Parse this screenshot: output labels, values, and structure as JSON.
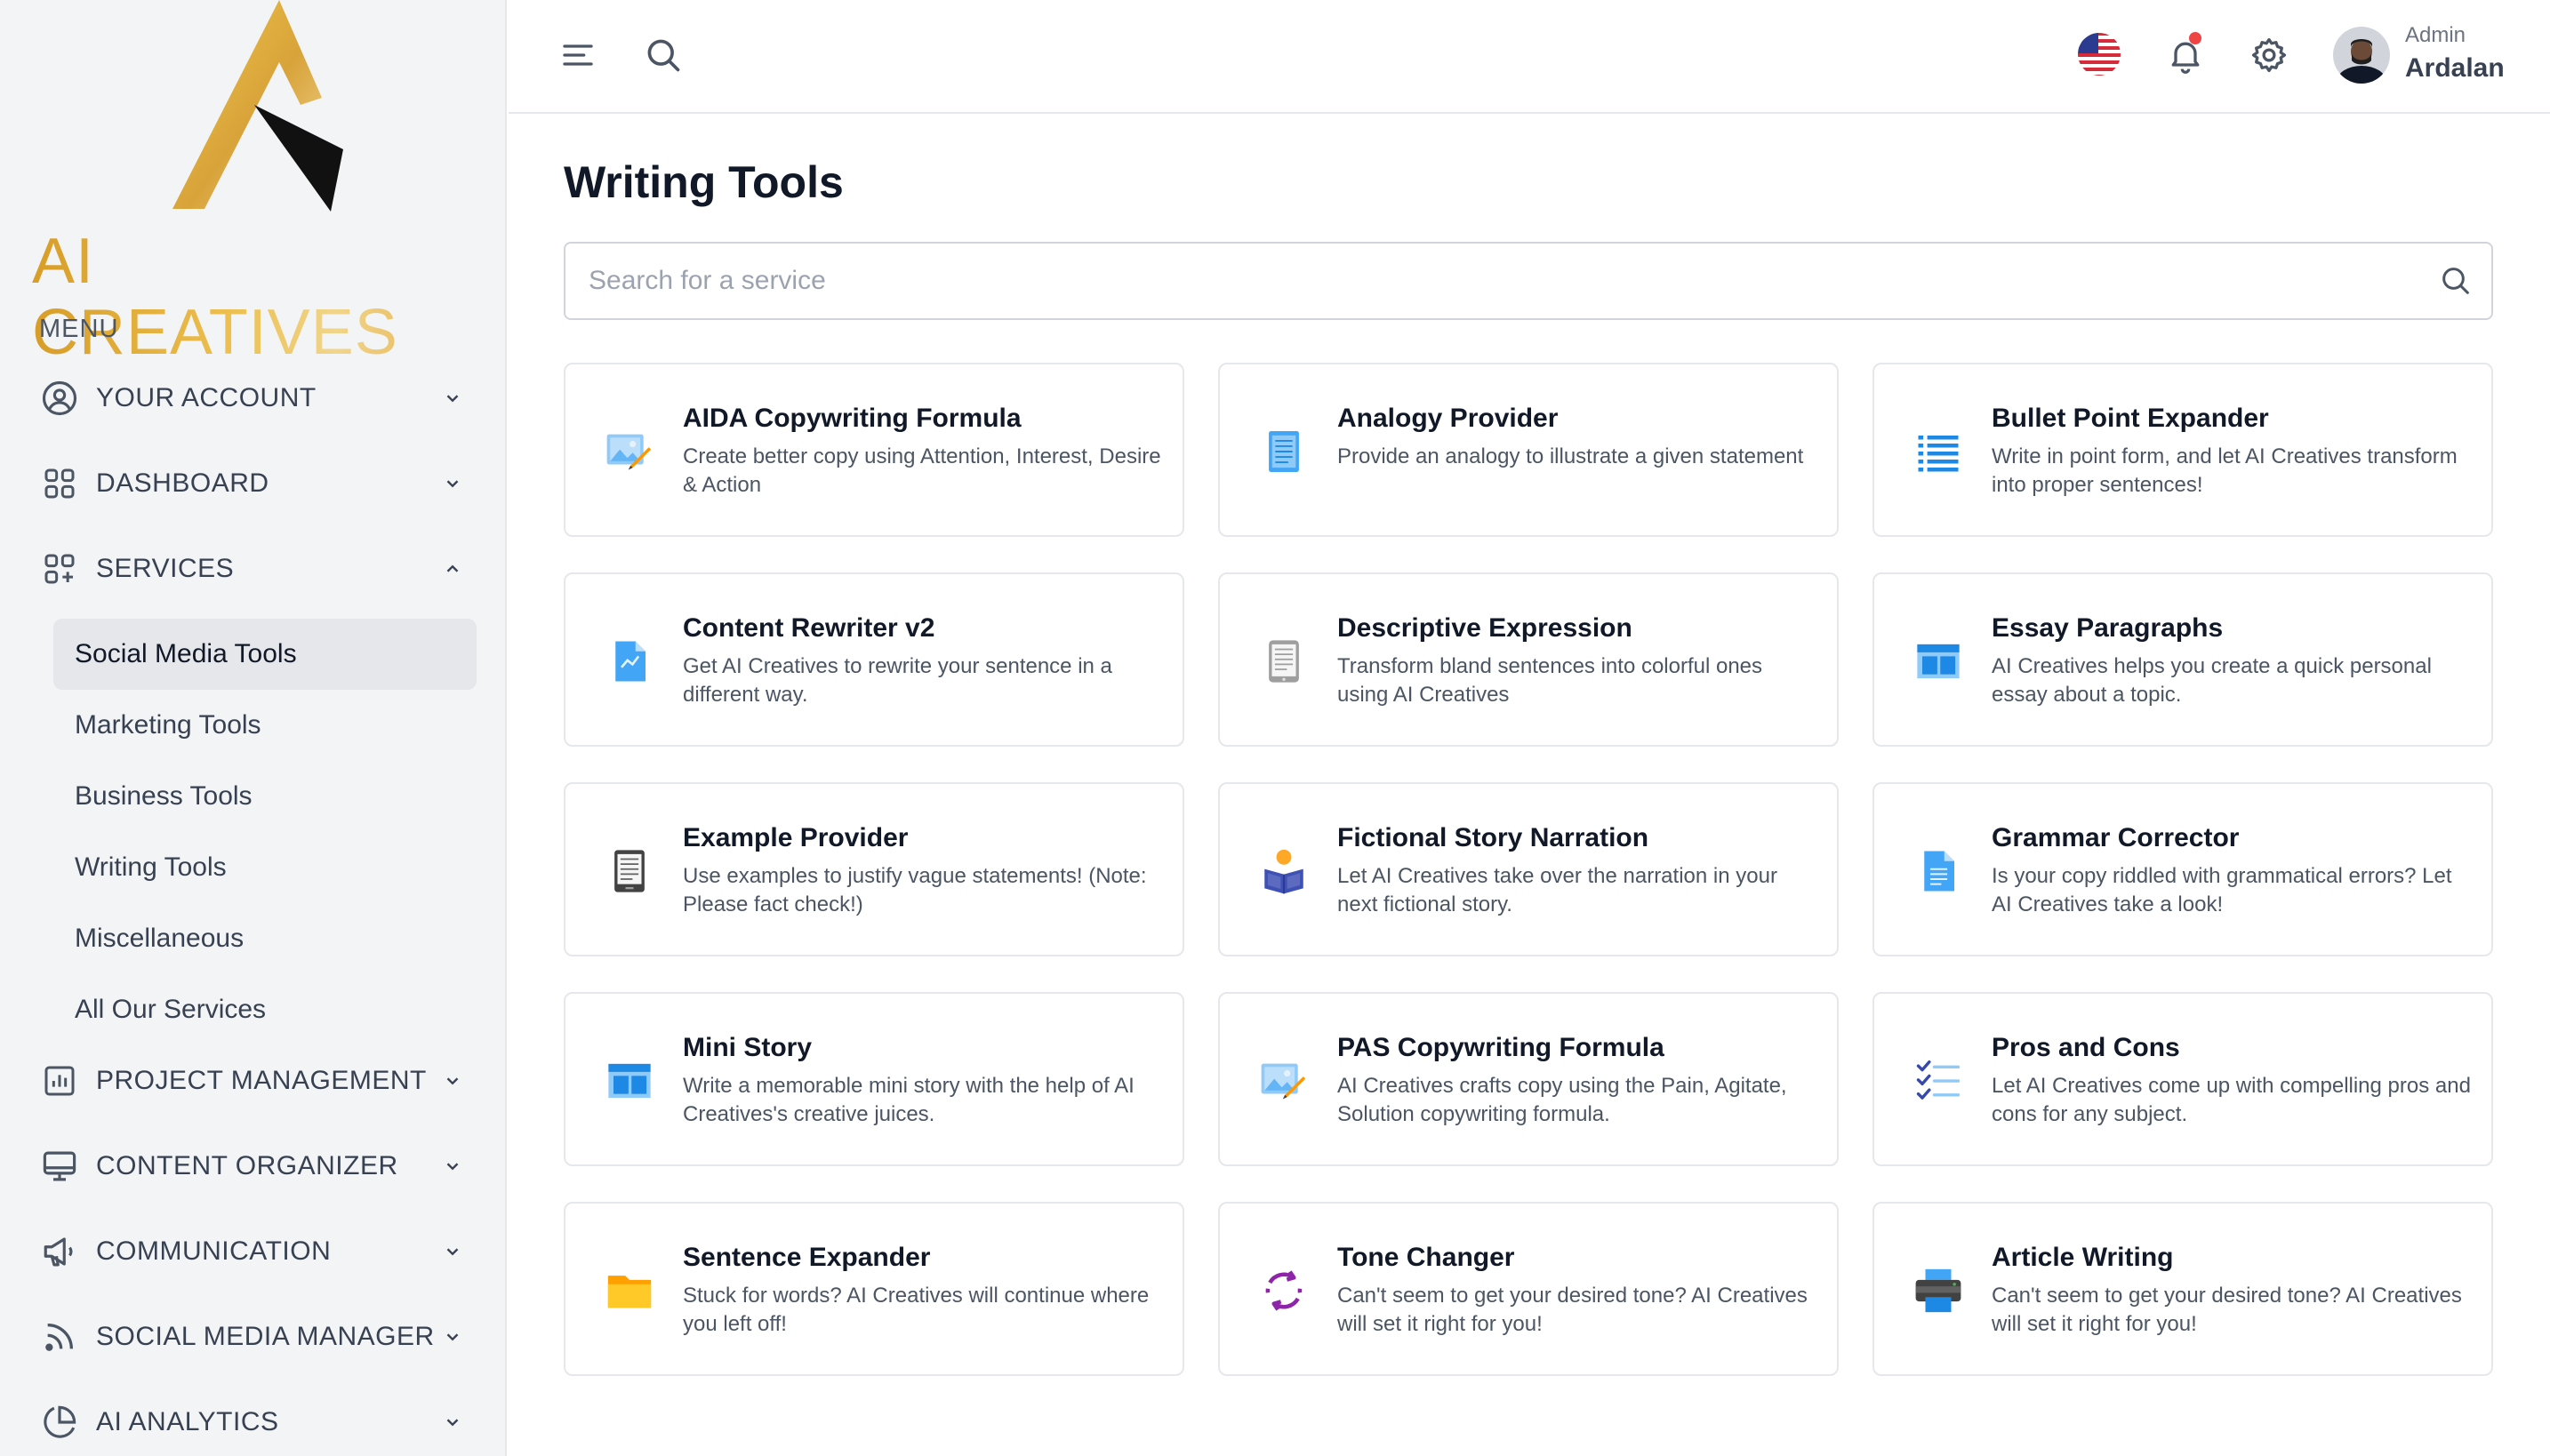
{
  "brand": {
    "name": "AI CREATIVES"
  },
  "sidebar": {
    "menu_label": "MENU",
    "items": [
      {
        "label": "YOUR ACCOUNT",
        "icon": "user-circle-icon",
        "expanded": false
      },
      {
        "label": "DASHBOARD",
        "icon": "dashboard-grid-icon",
        "expanded": false
      },
      {
        "label": "SERVICES",
        "icon": "services-grid-plus-icon",
        "expanded": true
      },
      {
        "label": "PROJECT MANAGEMENT",
        "icon": "bar-chart-icon",
        "expanded": false
      },
      {
        "label": "CONTENT ORGANIZER",
        "icon": "monitor-icon",
        "expanded": false
      },
      {
        "label": "COMMUNICATION",
        "icon": "megaphone-icon",
        "expanded": false
      },
      {
        "label": "SOCIAL MEDIA MANAGER",
        "icon": "rss-icon",
        "expanded": false
      },
      {
        "label": "AI ANALYTICS",
        "icon": "pie-chart-icon",
        "expanded": false
      }
    ],
    "services_submenu": [
      {
        "label": "Social Media Tools",
        "active": true
      },
      {
        "label": "Marketing Tools",
        "active": false
      },
      {
        "label": "Business Tools",
        "active": false
      },
      {
        "label": "Writing Tools",
        "active": false
      },
      {
        "label": "Miscellaneous",
        "active": false
      },
      {
        "label": "All Our Services",
        "active": false
      }
    ]
  },
  "topbar": {
    "menu_icon": "hamburger-menu-icon",
    "search_icon": "search-icon",
    "flag_icon": "us-flag-icon",
    "notification_icon": "bell-icon",
    "notification_dot_color": "#ef4444",
    "settings_icon": "gear-icon",
    "user": {
      "role": "Admin",
      "name": "Ardalan"
    }
  },
  "main": {
    "title": "Writing Tools",
    "search": {
      "placeholder": "Search for a service",
      "value": ""
    },
    "cards": [
      {
        "title": "AIDA Copywriting Formula",
        "desc": "Create better copy using Attention, Interest, Desire & Action",
        "icon": "picture-pencil-icon"
      },
      {
        "title": "Analogy Provider",
        "desc": "Provide an analogy to illustrate a given statement",
        "icon": "notepad-icon"
      },
      {
        "title": "Bullet Point Expander",
        "desc": "Write in point form, and let AI Creatives transform into proper sentences!",
        "icon": "bullet-list-icon"
      },
      {
        "title": "Content Rewriter v2",
        "desc": "Get AI Creatives to rewrite your sentence in a different way.",
        "icon": "chart-document-icon"
      },
      {
        "title": "Descriptive Expression",
        "desc": "Transform bland sentences into colorful ones using AI Creatives",
        "icon": "tablet-document-icon"
      },
      {
        "title": "Essay Paragraphs",
        "desc": "AI Creatives helps you create a quick personal essay about a topic.",
        "icon": "layout-window-icon"
      },
      {
        "title": "Example Provider",
        "desc": "Use examples to justify vague statements! (Note: Please fact check!)",
        "icon": "ebook-reader-icon"
      },
      {
        "title": "Fictional Story Narration",
        "desc": "Let AI Creatives take over the narration in your next fictional story.",
        "icon": "reading-person-icon"
      },
      {
        "title": "Grammar Corrector",
        "desc": "Is your copy riddled with grammatical errors? Let AI Creatives take a look!",
        "icon": "text-document-icon"
      },
      {
        "title": "Mini Story",
        "desc": "Write a memorable mini story with the help of AI Creatives's creative juices.",
        "icon": "layout-window-icon"
      },
      {
        "title": "PAS Copywriting Formula",
        "desc": "AI Creatives crafts copy using the Pain, Agitate, Solution copywriting formula.",
        "icon": "picture-pencil-icon"
      },
      {
        "title": "Pros and Cons",
        "desc": "Let AI Creatives come up with compelling pros and cons for any subject.",
        "icon": "checklist-icon"
      },
      {
        "title": "Sentence Expander",
        "desc": "Stuck for words? AI Creatives will continue where you left off!",
        "icon": "folder-icon"
      },
      {
        "title": "Tone Changer",
        "desc": "Can't seem to get your desired tone? AI Creatives will set it right for you!",
        "icon": "refresh-arrows-icon"
      },
      {
        "title": "Article Writing",
        "desc": "Can't seem to get your desired tone? AI Creatives will set it right for you!",
        "icon": "printer-icon"
      }
    ]
  }
}
